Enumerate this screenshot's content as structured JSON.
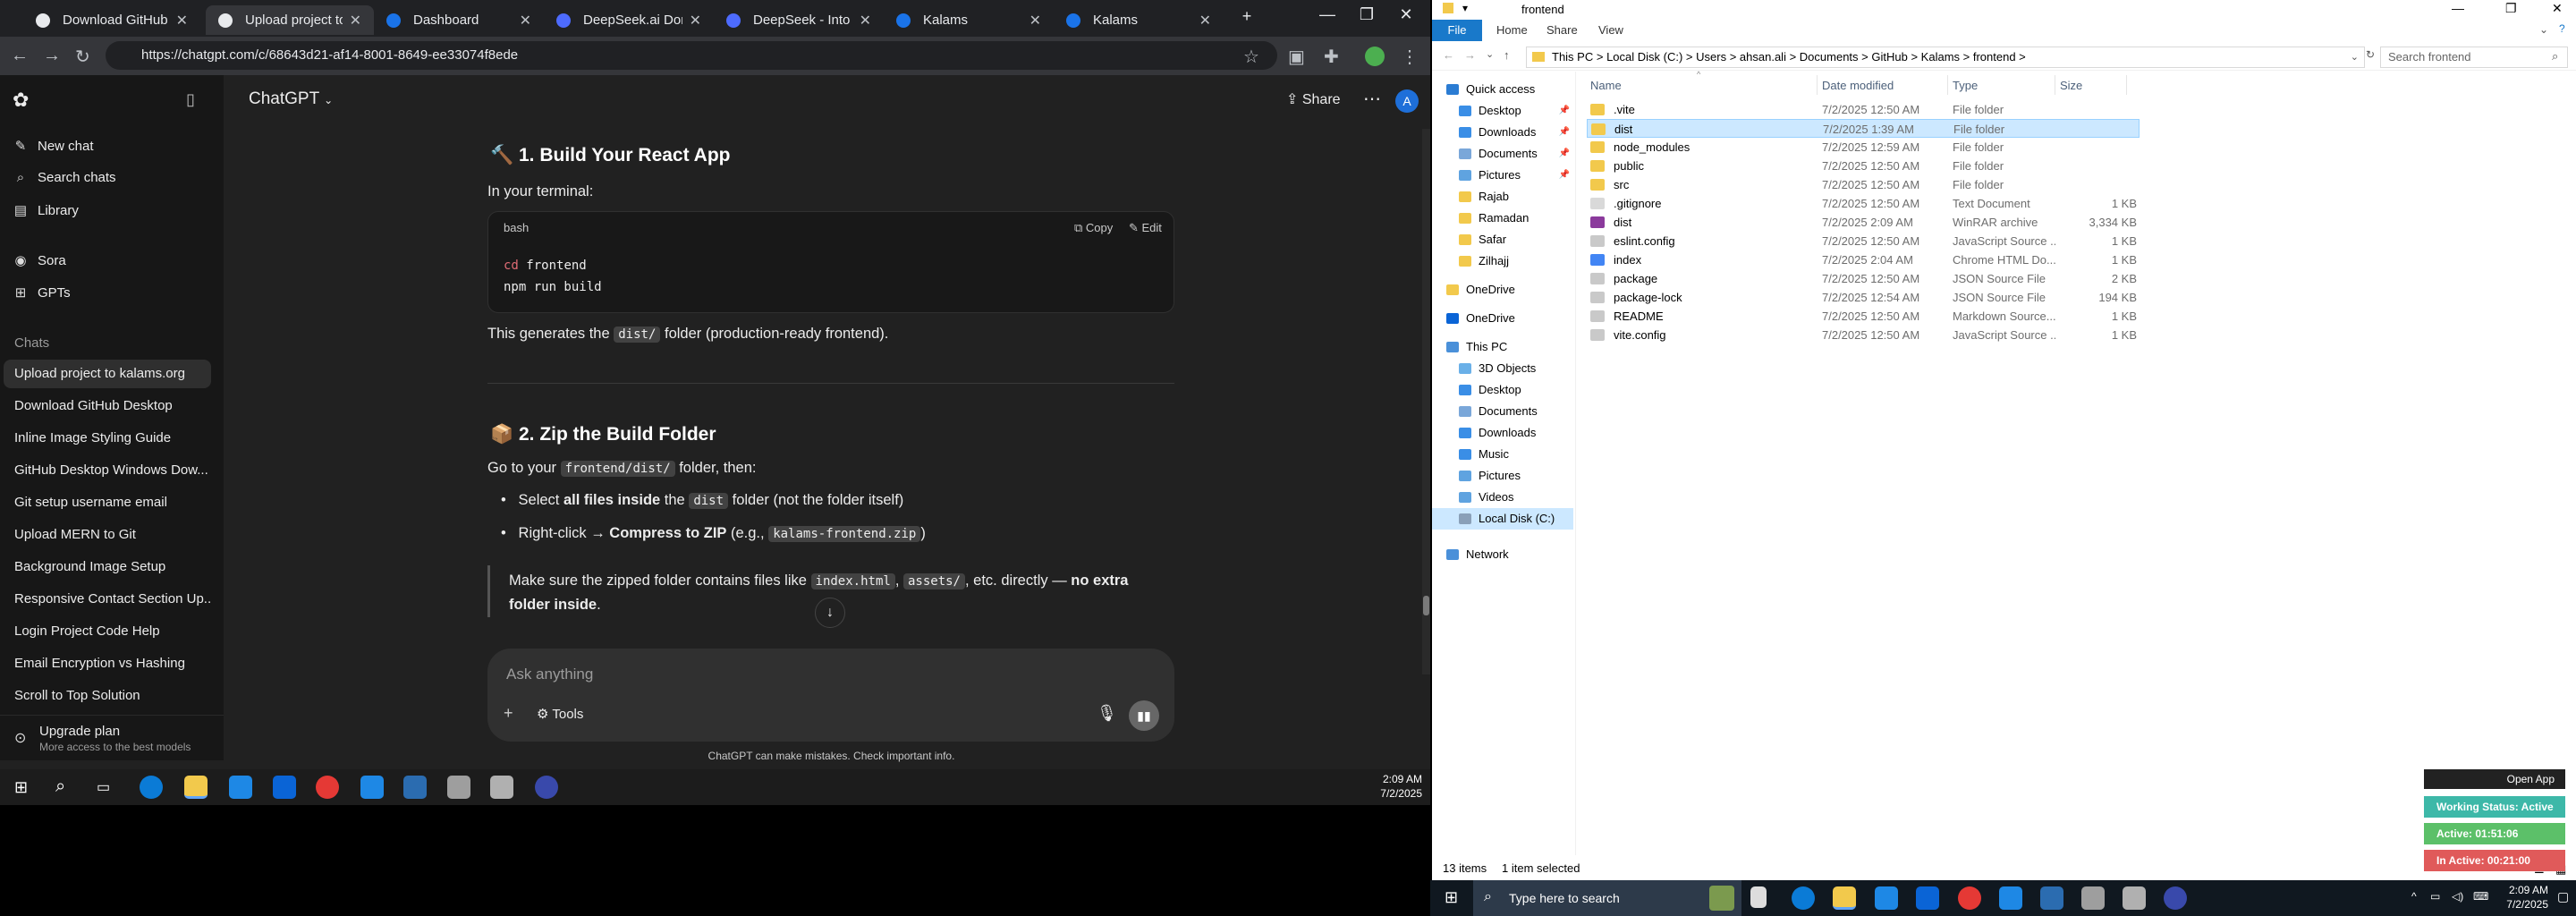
{
  "browser": {
    "tabs": [
      {
        "label": "Download GitHub Des",
        "color": "#24292f"
      },
      {
        "label": "Upload project to kala",
        "color": "#ffffff"
      },
      {
        "label": "Dashboard",
        "color": "#1a73e8"
      },
      {
        "label": "DeepSeek.ai Domain F",
        "color": "#4d6bfe"
      },
      {
        "label": "DeepSeek - Into the U",
        "color": "#4d6bfe"
      },
      {
        "label": "Kalams",
        "color": "#1a73e8"
      },
      {
        "label": "Kalams",
        "color": "#1a73e8"
      }
    ],
    "new_tab": "+",
    "url": "https://chatgpt.com/c/68643d21-af14-8001-8649-ee33074f8ede"
  },
  "sidebar": {
    "top_items": [
      {
        "label": "New chat",
        "icon": "compose-icon"
      },
      {
        "label": "Search chats",
        "icon": "search-icon"
      },
      {
        "label": "Library",
        "icon": "library-icon"
      },
      {
        "label": "Sora",
        "icon": "sora-icon"
      },
      {
        "label": "GPTs",
        "icon": "grid-icon"
      }
    ],
    "chats_heading": "Chats",
    "chats": [
      "Upload project to kalams.org",
      "Download GitHub Desktop",
      "Inline Image Styling Guide",
      "GitHub Desktop Windows Dow...",
      "Git setup username email",
      "Upload MERN to Git",
      "Background Image Setup",
      "Responsive Contact Section Up...",
      "Login Project Code Help",
      "Email Encryption vs Hashing",
      "Scroll to Top Solution"
    ],
    "upgrade_title": "Upgrade plan",
    "upgrade_sub": "More access to the best models"
  },
  "main": {
    "model_label": "ChatGPT",
    "share_label": "Share",
    "avatar_letter": "A",
    "section1_title": "1. Build Your React App",
    "section1_intro": "In your terminal:",
    "code_lang": "bash",
    "copy_label": "Copy",
    "edit_label": "Edit",
    "code_line1_cmd": "cd",
    "code_line1_arg": "frontend",
    "code_line2": "npm run build",
    "generates_pre": "This generates the ",
    "generates_code": "dist/",
    "generates_post": " folder (production-ready frontend).",
    "section2_title": "2. Zip the Build Folder",
    "goto_pre": "Go to your ",
    "goto_code": "frontend/dist/",
    "goto_post": " folder, then:",
    "bullet1_pre": "Select ",
    "bullet1_bold": "all files inside",
    "bullet1_mid": " the ",
    "bullet1_code": "dist",
    "bullet1_post": " folder (not the folder itself)",
    "bullet2_pre": "Right-click → ",
    "bullet2_bold": "Compress to ZIP",
    "bullet2_mid": " (e.g., ",
    "bullet2_code": "kalams-frontend.zip",
    "bullet2_post": ")",
    "quote_pre": "Make sure the zipped folder contains files like ",
    "quote_code1": "index.html",
    "quote_sep": ", ",
    "quote_code2": "assets/",
    "quote_mid": ", etc. directly — ",
    "quote_bold": "no extra folder inside",
    "quote_end": ".",
    "composer_placeholder": "Ask anything",
    "tools_label": "Tools",
    "disclaimer": "ChatGPT can make mistakes. Check important info."
  },
  "taskbar_left": {
    "time": "2:09 AM",
    "date": "7/2/2025"
  },
  "explorer": {
    "title": "frontend",
    "ribbon_tabs": [
      "File",
      "Home",
      "Share",
      "View"
    ],
    "breadcrumb": [
      "This PC",
      "Local Disk (C:)",
      "Users",
      "ahsan.ali",
      "Documents",
      "GitHub",
      "Kalams",
      "frontend"
    ],
    "search_placeholder": "Search frontend",
    "nav": [
      {
        "label": "Quick access",
        "level": 0,
        "icon": "star-icon",
        "color": "#2b7cd3"
      },
      {
        "label": "Desktop",
        "level": 1,
        "icon": "desktop-icon",
        "color": "#3a8ee6",
        "pinned": true
      },
      {
        "label": "Downloads",
        "level": 1,
        "icon": "download-icon",
        "color": "#3a8ee6",
        "pinned": true
      },
      {
        "label": "Documents",
        "level": 1,
        "icon": "document-icon",
        "color": "#7aa7d9",
        "pinned": true
      },
      {
        "label": "Pictures",
        "level": 1,
        "icon": "picture-icon",
        "color": "#5fa3e0",
        "pinned": true
      },
      {
        "label": "Rajab",
        "level": 1,
        "icon": "folder-icon",
        "color": "#f2c94c"
      },
      {
        "label": "Ramadan",
        "level": 1,
        "icon": "folder-icon",
        "color": "#f2c94c"
      },
      {
        "label": "Safar",
        "level": 1,
        "icon": "folder-icon",
        "color": "#f2c94c"
      },
      {
        "label": "Zilhajj",
        "level": 1,
        "icon": "folder-icon",
        "color": "#f2c94c"
      },
      {
        "label": "OneDrive",
        "level": 0,
        "icon": "folder-icon",
        "color": "#f2c94c"
      },
      {
        "label": "OneDrive",
        "level": 0,
        "icon": "cloud-icon",
        "color": "#0a64d6"
      },
      {
        "label": "This PC",
        "level": 0,
        "icon": "computer-icon",
        "color": "#4a90d9"
      },
      {
        "label": "3D Objects",
        "level": 1,
        "icon": "cube-icon",
        "color": "#6ab0e8"
      },
      {
        "label": "Desktop",
        "level": 1,
        "icon": "desktop-icon",
        "color": "#3a8ee6"
      },
      {
        "label": "Documents",
        "level": 1,
        "icon": "document-icon",
        "color": "#7aa7d9"
      },
      {
        "label": "Downloads",
        "level": 1,
        "icon": "download-icon",
        "color": "#3a8ee6"
      },
      {
        "label": "Music",
        "level": 1,
        "icon": "music-icon",
        "color": "#3a8ee6"
      },
      {
        "label": "Pictures",
        "level": 1,
        "icon": "picture-icon",
        "color": "#5fa3e0"
      },
      {
        "label": "Videos",
        "level": 1,
        "icon": "video-icon",
        "color": "#5fa3e0"
      },
      {
        "label": "Local Disk (C:)",
        "level": 1,
        "icon": "drive-icon",
        "color": "#8aa0b8",
        "selected": true
      },
      {
        "label": "Network",
        "level": 0,
        "icon": "network-icon",
        "color": "#4a90d9"
      }
    ],
    "columns": [
      "Name",
      "Date modified",
      "Type",
      "Size"
    ],
    "files": [
      {
        "name": ".vite",
        "date": "7/2/2025 12:50 AM",
        "type": "File folder",
        "size": "",
        "icon": "folder-icon",
        "color": "#f2c94c"
      },
      {
        "name": "dist",
        "date": "7/2/2025 1:39 AM",
        "type": "File folder",
        "size": "",
        "icon": "folder-icon",
        "color": "#f2c94c",
        "selected": true
      },
      {
        "name": "node_modules",
        "date": "7/2/2025 12:59 AM",
        "type": "File folder",
        "size": "",
        "icon": "folder-icon",
        "color": "#f2c94c"
      },
      {
        "name": "public",
        "date": "7/2/2025 12:50 AM",
        "type": "File folder",
        "size": "",
        "icon": "folder-icon",
        "color": "#f2c94c"
      },
      {
        "name": "src",
        "date": "7/2/2025 12:50 AM",
        "type": "File folder",
        "size": "",
        "icon": "folder-icon",
        "color": "#f2c94c"
      },
      {
        "name": ".gitignore",
        "date": "7/2/2025 12:50 AM",
        "type": "Text Document",
        "size": "1 KB",
        "icon": "text-file-icon",
        "color": "#d9d9d9"
      },
      {
        "name": "dist",
        "date": "7/2/2025 2:09 AM",
        "type": "WinRAR archive",
        "size": "3,334 KB",
        "icon": "archive-icon",
        "color": "#8b3a9c"
      },
      {
        "name": "eslint.config",
        "date": "7/2/2025 12:50 AM",
        "type": "JavaScript Source ...",
        "size": "1 KB",
        "icon": "script-file-icon",
        "color": "#c9c9c9"
      },
      {
        "name": "index",
        "date": "7/2/2025 2:04 AM",
        "type": "Chrome HTML Do...",
        "size": "1 KB",
        "icon": "chrome-file-icon",
        "color": "#4285f4"
      },
      {
        "name": "package",
        "date": "7/2/2025 12:50 AM",
        "type": "JSON Source File",
        "size": "2 KB",
        "icon": "json-file-icon",
        "color": "#c9c9c9"
      },
      {
        "name": "package-lock",
        "date": "7/2/2025 12:54 AM",
        "type": "JSON Source File",
        "size": "194 KB",
        "icon": "json-file-icon",
        "color": "#c9c9c9"
      },
      {
        "name": "README",
        "date": "7/2/2025 12:50 AM",
        "type": "Markdown Source...",
        "size": "1 KB",
        "icon": "markdown-file-icon",
        "color": "#c9c9c9"
      },
      {
        "name": "vite.config",
        "date": "7/2/2025 12:50 AM",
        "type": "JavaScript Source ...",
        "size": "1 KB",
        "icon": "script-file-icon",
        "color": "#c9c9c9"
      }
    ],
    "status_items": "13 items",
    "status_selected": "1 item selected"
  },
  "taskbar_right": {
    "search_placeholder": "Type here to search",
    "time": "2:09 AM",
    "date": "7/2/2025"
  },
  "widget": {
    "open_app": "Open App",
    "working": "Working Status: Active",
    "active": "Active: 01:51:06",
    "inactive": "In Active: 00:21:00"
  }
}
